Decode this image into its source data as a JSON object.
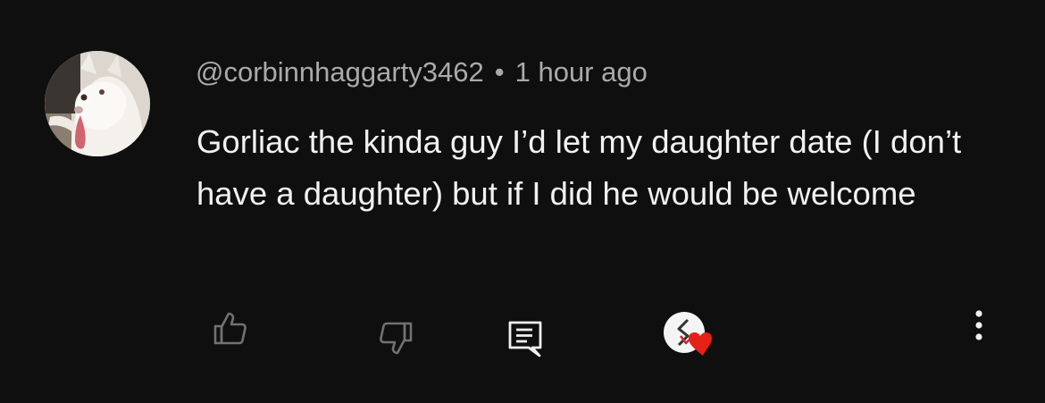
{
  "comment": {
    "author": "@corbinnhaggarty3462",
    "separator": "•",
    "timestamp": "1 hour ago",
    "text": "Gorliac the kinda guy I’d let my daughter date (I don’t have a daughter) but if I did he would be welcome"
  },
  "actions": {
    "like_icon": "thumbs-up-icon",
    "dislike_icon": "thumbs-down-icon",
    "reply_icon": "comment-reply-icon",
    "creator_heart_icon": "creator-heart-icon",
    "more_icon": "more-vertical-icon"
  },
  "colors": {
    "background": "#0f0f0f",
    "meta_text": "#aaaaaa",
    "body_text": "#f1f1f1",
    "icon_muted": "#717171",
    "icon_active": "#f1f1f1",
    "heart": "#e62117"
  }
}
